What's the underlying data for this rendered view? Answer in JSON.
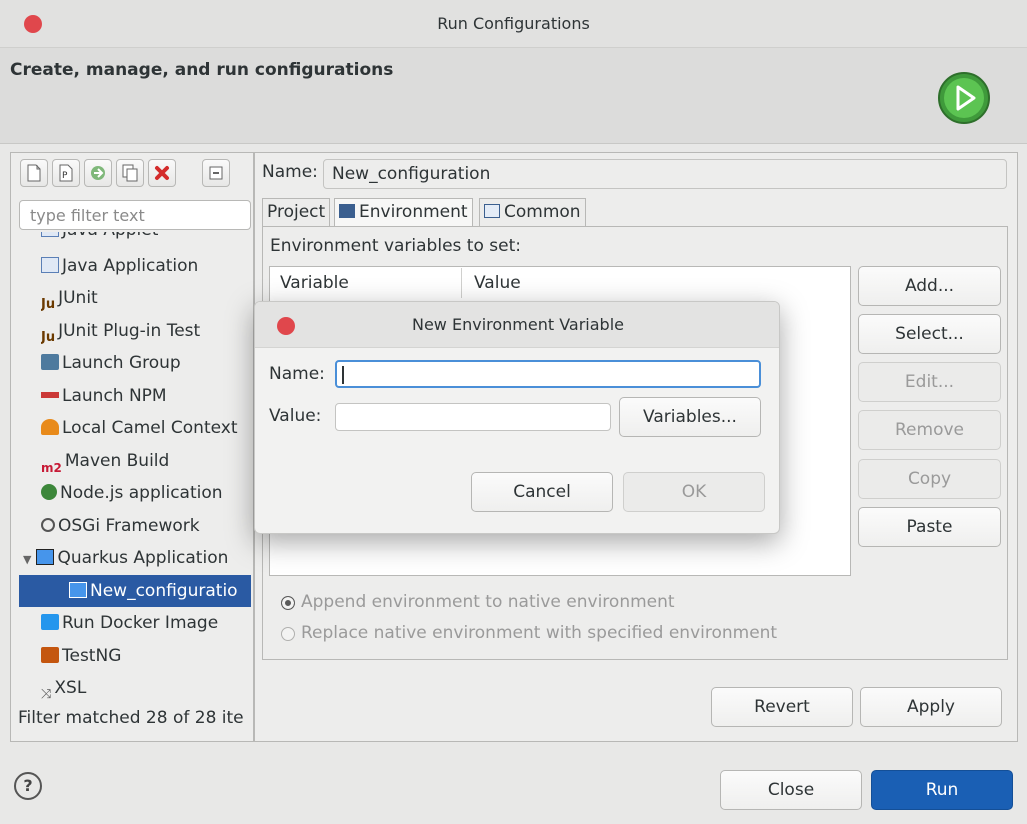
{
  "window": {
    "title": "Run Configurations"
  },
  "banner": {
    "title": "Create, manage, and run configurations",
    "icon": "run-icon",
    "accent": "#4caf50"
  },
  "left": {
    "filter_placeholder": "type filter text",
    "tree": [
      {
        "label": "Java Applet",
        "icon": "java-applet-icon"
      },
      {
        "label": "Java Application",
        "icon": "java-application-icon"
      },
      {
        "label": "JUnit",
        "icon": "junit-icon"
      },
      {
        "label": "JUnit Plug-in Test",
        "icon": "junit-plugin-icon"
      },
      {
        "label": "Launch Group",
        "icon": "launch-group-icon"
      },
      {
        "label": "Launch NPM",
        "icon": "npm-icon"
      },
      {
        "label": "Local Camel Context",
        "icon": "camel-icon"
      },
      {
        "label": "Maven Build",
        "icon": "maven-icon"
      },
      {
        "label": "Node.js application",
        "icon": "nodejs-icon"
      },
      {
        "label": "OSGi Framework",
        "icon": "osgi-icon"
      },
      {
        "label": "Quarkus Application",
        "icon": "quarkus-icon"
      },
      {
        "label": "New_configuratio",
        "icon": "quarkus-config-icon"
      },
      {
        "label": "Run Docker Image",
        "icon": "docker-icon"
      },
      {
        "label": "TestNG",
        "icon": "testng-icon"
      },
      {
        "label": "XSL",
        "icon": "xsl-icon"
      }
    ],
    "status": "Filter matched 28 of 28 ite"
  },
  "main": {
    "name_label": "Name:",
    "name_value": "New_configuration",
    "tabs": [
      {
        "label": "Project"
      },
      {
        "label": "Environment"
      },
      {
        "label": "Common"
      }
    ],
    "env_label": "Environment variables to set:",
    "columns": [
      "Variable",
      "Value"
    ],
    "buttons": {
      "add": "Add...",
      "select": "Select...",
      "edit": "Edit...",
      "remove": "Remove",
      "copy": "Copy",
      "paste": "Paste"
    },
    "radio_append": "Append environment to native environment",
    "radio_replace": "Replace native environment with specified environment",
    "revert": "Revert",
    "apply": "Apply"
  },
  "footer": {
    "close": "Close",
    "run": "Run",
    "run_color": "#1a5fb4"
  },
  "dialog": {
    "title": "New Environment Variable",
    "name_label": "Name:",
    "value_label": "Value:",
    "variables": "Variables...",
    "cancel": "Cancel",
    "ok": "OK"
  }
}
